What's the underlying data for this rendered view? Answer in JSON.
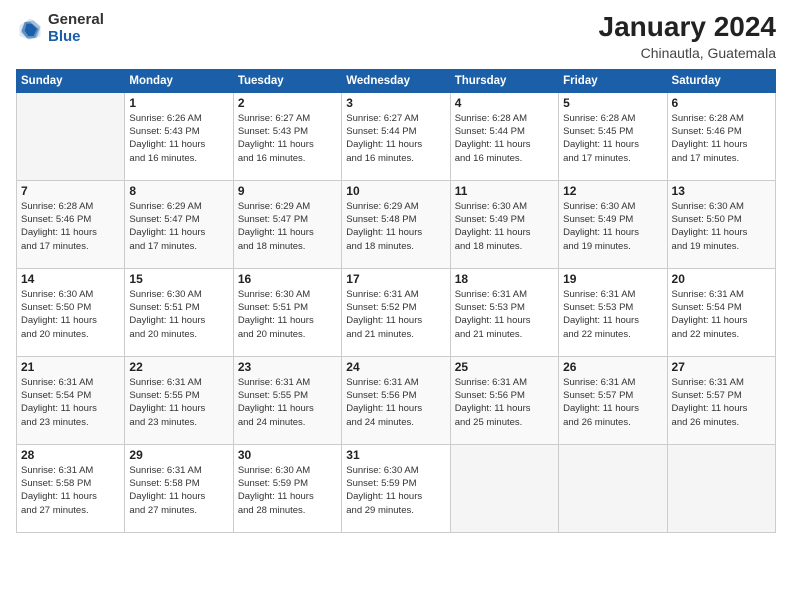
{
  "logo": {
    "general": "General",
    "blue": "Blue"
  },
  "title": "January 2024",
  "subtitle": "Chinautla, Guatemala",
  "days_header": [
    "Sunday",
    "Monday",
    "Tuesday",
    "Wednesday",
    "Thursday",
    "Friday",
    "Saturday"
  ],
  "weeks": [
    [
      {
        "day": "",
        "info": ""
      },
      {
        "day": "1",
        "info": "Sunrise: 6:26 AM\nSunset: 5:43 PM\nDaylight: 11 hours\nand 16 minutes."
      },
      {
        "day": "2",
        "info": "Sunrise: 6:27 AM\nSunset: 5:43 PM\nDaylight: 11 hours\nand 16 minutes."
      },
      {
        "day": "3",
        "info": "Sunrise: 6:27 AM\nSunset: 5:44 PM\nDaylight: 11 hours\nand 16 minutes."
      },
      {
        "day": "4",
        "info": "Sunrise: 6:28 AM\nSunset: 5:44 PM\nDaylight: 11 hours\nand 16 minutes."
      },
      {
        "day": "5",
        "info": "Sunrise: 6:28 AM\nSunset: 5:45 PM\nDaylight: 11 hours\nand 17 minutes."
      },
      {
        "day": "6",
        "info": "Sunrise: 6:28 AM\nSunset: 5:46 PM\nDaylight: 11 hours\nand 17 minutes."
      }
    ],
    [
      {
        "day": "7",
        "info": "Sunrise: 6:28 AM\nSunset: 5:46 PM\nDaylight: 11 hours\nand 17 minutes."
      },
      {
        "day": "8",
        "info": "Sunrise: 6:29 AM\nSunset: 5:47 PM\nDaylight: 11 hours\nand 17 minutes."
      },
      {
        "day": "9",
        "info": "Sunrise: 6:29 AM\nSunset: 5:47 PM\nDaylight: 11 hours\nand 18 minutes."
      },
      {
        "day": "10",
        "info": "Sunrise: 6:29 AM\nSunset: 5:48 PM\nDaylight: 11 hours\nand 18 minutes."
      },
      {
        "day": "11",
        "info": "Sunrise: 6:30 AM\nSunset: 5:49 PM\nDaylight: 11 hours\nand 18 minutes."
      },
      {
        "day": "12",
        "info": "Sunrise: 6:30 AM\nSunset: 5:49 PM\nDaylight: 11 hours\nand 19 minutes."
      },
      {
        "day": "13",
        "info": "Sunrise: 6:30 AM\nSunset: 5:50 PM\nDaylight: 11 hours\nand 19 minutes."
      }
    ],
    [
      {
        "day": "14",
        "info": "Sunrise: 6:30 AM\nSunset: 5:50 PM\nDaylight: 11 hours\nand 20 minutes."
      },
      {
        "day": "15",
        "info": "Sunrise: 6:30 AM\nSunset: 5:51 PM\nDaylight: 11 hours\nand 20 minutes."
      },
      {
        "day": "16",
        "info": "Sunrise: 6:30 AM\nSunset: 5:51 PM\nDaylight: 11 hours\nand 20 minutes."
      },
      {
        "day": "17",
        "info": "Sunrise: 6:31 AM\nSunset: 5:52 PM\nDaylight: 11 hours\nand 21 minutes."
      },
      {
        "day": "18",
        "info": "Sunrise: 6:31 AM\nSunset: 5:53 PM\nDaylight: 11 hours\nand 21 minutes."
      },
      {
        "day": "19",
        "info": "Sunrise: 6:31 AM\nSunset: 5:53 PM\nDaylight: 11 hours\nand 22 minutes."
      },
      {
        "day": "20",
        "info": "Sunrise: 6:31 AM\nSunset: 5:54 PM\nDaylight: 11 hours\nand 22 minutes."
      }
    ],
    [
      {
        "day": "21",
        "info": "Sunrise: 6:31 AM\nSunset: 5:54 PM\nDaylight: 11 hours\nand 23 minutes."
      },
      {
        "day": "22",
        "info": "Sunrise: 6:31 AM\nSunset: 5:55 PM\nDaylight: 11 hours\nand 23 minutes."
      },
      {
        "day": "23",
        "info": "Sunrise: 6:31 AM\nSunset: 5:55 PM\nDaylight: 11 hours\nand 24 minutes."
      },
      {
        "day": "24",
        "info": "Sunrise: 6:31 AM\nSunset: 5:56 PM\nDaylight: 11 hours\nand 24 minutes."
      },
      {
        "day": "25",
        "info": "Sunrise: 6:31 AM\nSunset: 5:56 PM\nDaylight: 11 hours\nand 25 minutes."
      },
      {
        "day": "26",
        "info": "Sunrise: 6:31 AM\nSunset: 5:57 PM\nDaylight: 11 hours\nand 26 minutes."
      },
      {
        "day": "27",
        "info": "Sunrise: 6:31 AM\nSunset: 5:57 PM\nDaylight: 11 hours\nand 26 minutes."
      }
    ],
    [
      {
        "day": "28",
        "info": "Sunrise: 6:31 AM\nSunset: 5:58 PM\nDaylight: 11 hours\nand 27 minutes."
      },
      {
        "day": "29",
        "info": "Sunrise: 6:31 AM\nSunset: 5:58 PM\nDaylight: 11 hours\nand 27 minutes."
      },
      {
        "day": "30",
        "info": "Sunrise: 6:30 AM\nSunset: 5:59 PM\nDaylight: 11 hours\nand 28 minutes."
      },
      {
        "day": "31",
        "info": "Sunrise: 6:30 AM\nSunset: 5:59 PM\nDaylight: 11 hours\nand 29 minutes."
      },
      {
        "day": "",
        "info": ""
      },
      {
        "day": "",
        "info": ""
      },
      {
        "day": "",
        "info": ""
      }
    ]
  ]
}
